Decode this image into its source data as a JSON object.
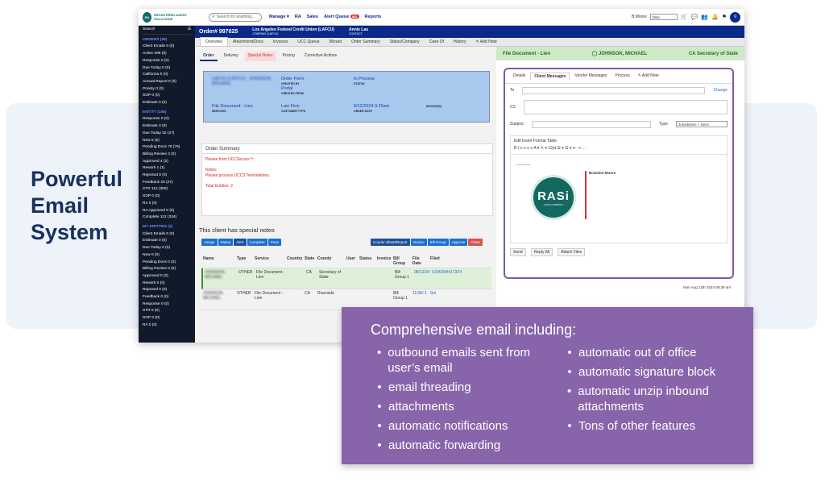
{
  "heading": {
    "lines": [
      "Powerful",
      "Email",
      "System"
    ]
  },
  "app": {
    "logo_initials": "RA",
    "logo_text": "REGISTERED AGENT SOLUTIONS",
    "search_placeholder": "Search for anything...",
    "nav": [
      "Manage ▾",
      "RA",
      "Sales",
      "Alert Queue",
      "Reports"
    ],
    "alert_count": "682",
    "user": "B.Moore",
    "user_select": "Misc",
    "sidebar": {
      "search_label": "Search",
      "sections": [
        {
          "title": "ORDERS (89)",
          "items": [
            "Client Emails 0 (0)",
            "Active 295 (0)",
            "Response 0 (0)",
            "Due Today 0 (0)",
            "California 0 (0)",
            "Annual Report 0 (0)",
            "Priority 0 (0)",
            "SOP 0 (0)",
            "Estimate 0 (0)"
          ]
        },
        {
          "title": "ENTITY (156)",
          "items": [
            "Response 0 (0)",
            "Estimate 3 (0)",
            "Due Today 32 (27)",
            "New 5 (5)",
            "Pending Docs 75 (75)",
            "Billing Review 3 (0)",
            "Approved 4 (2)",
            "Rework 1 (1)",
            "Rejected 0 (0)",
            "Feedback 26 (27)",
            "STR 112 (350)",
            "SOP 0 (0)",
            "RA 0 (0)",
            "RA Approved 0 (0)",
            "Complete 112 (334)"
          ]
        },
        {
          "title": "MY ENTITIES (2)",
          "items": [
            "Client Emails 0 (0)",
            "Estimate 0 (0)",
            "Due Today 0 (0)",
            "New 0 (0)",
            "Pending Docs 0 (0)",
            "Billing Review 0 (0)",
            "Approved 0 (0)",
            "Rework 0 (0)",
            "Rejected 0 (0)",
            "Feedback 0 (0)",
            "Response 0 (0)",
            "STR 0 (0)",
            "SOP 0 (0)",
            "RA 0 (0)"
          ]
        }
      ]
    },
    "order": {
      "number": "Order# 997025",
      "client": "Los Angeles Federal Credit Union (LAFCU)",
      "client_sub": "COMPANY (LAFCU)",
      "contact": "Annie Lau",
      "contact_sub": "CONTACT"
    },
    "tabs": [
      "Overview",
      "Attachment/Docs",
      "Invoices",
      "UCC Queue",
      "Wizard",
      "Order Summary",
      "Status/Company",
      "Case Of",
      "History",
      "✎ Add Note"
    ],
    "subtabs": [
      "Order",
      "Delivery",
      "Special Notes",
      "Pricing",
      "Corrective Actions"
    ],
    "blue": {
      "r1c1": "LAFCU (LAFCU) - JOHNSON, MICHAEL",
      "r1c2": "Order Form",
      "r1c2b": "Portal",
      "r1c3": "In Process",
      "r1c3s": "STATUS",
      "r1c2s": "CREATED BY",
      "r1c2s2": "CREATED FROM",
      "r2c1": "File Document - Lien",
      "r2c1s": "SERVICES",
      "r2c2": "Law Firm",
      "r2c2s": "CUSTOMER TYPE",
      "r2c3": "8/12/2024 9:26am",
      "r2c3s": "ORDER DATE",
      "r2c4s": "INVOICE(S)"
    },
    "summary": {
      "title": "Order Summary",
      "lines": [
        "Please from UCCSecure™.",
        "",
        "Notes:",
        "Please process UCC3 Terminations.",
        "",
        "Total Entities: 2"
      ]
    },
    "special_notes": "This client has special notes",
    "buttons_left": [
      "Assign",
      "Status",
      "Alert",
      "Complete",
      "Pass"
    ],
    "buttons_right": [
      "Courier Sheet/Report",
      "Invoice",
      "Bill Group",
      "Approve",
      "Close"
    ],
    "table": {
      "headers": [
        "Name",
        "Type",
        "Service",
        "Country",
        "State",
        "County",
        "User",
        "Status",
        "Invoice",
        "Bill Group",
        "File Date",
        "Filed"
      ],
      "rows": [
        [
          "JOHNSON, MICHAEL",
          "OTHER",
          "File Document - Lien",
          "",
          "CA",
          "Secretary of State",
          "",
          "",
          "",
          "Bill Group 1",
          "08/12/24",
          "U240094417324"
        ],
        [
          "JOHNSON, MICHAEL",
          "OTHER",
          "File Document - Lien",
          "",
          "CA",
          "Riverside",
          "",
          "",
          "",
          "Bill Group 1",
          "11/30/-1",
          "Sel"
        ]
      ]
    },
    "right": {
      "bar_left": "File Document - Lien",
      "bar_mid": "JOHNSON, MICHAEL",
      "bar_right": "CA Secretary of State",
      "email_tabs": [
        "Details",
        "Client Messages",
        "Vendor Messages",
        "Process",
        "✎ Add Note"
      ],
      "to_label": "To",
      "cc_label": "CC",
      "change": "Change",
      "subject_label": "Subject",
      "type_label": "Type",
      "type_value": "Jurisdiction + Servi",
      "menu": "Edit   Insert   Format   Table",
      "format_row": "B  I  ≡  ≡  ≡  ≡   A ▾   ✎ ▾   12pt   ☰ ▾  ☰ ▾  ⇤  ⇥  …",
      "sig_name": "Brandon Moore",
      "rasi_text": "RASi",
      "rasi_sub": "A CSC COMPANY",
      "email_buttons": [
        "Send",
        "Reply All",
        "Attach Files"
      ],
      "msg_date": "Mon Aug 12th 2024 08:39 am"
    }
  },
  "callout": {
    "title": "Comprehensive email including:",
    "left": [
      "outbound emails sent from user’s email",
      "email threading",
      "attachments",
      "automatic notifications",
      "automatic forwarding"
    ],
    "right": [
      "automatic out of office",
      "automatic signature block",
      "automatic unzip inbound attachments",
      "Tons of other features"
    ]
  }
}
